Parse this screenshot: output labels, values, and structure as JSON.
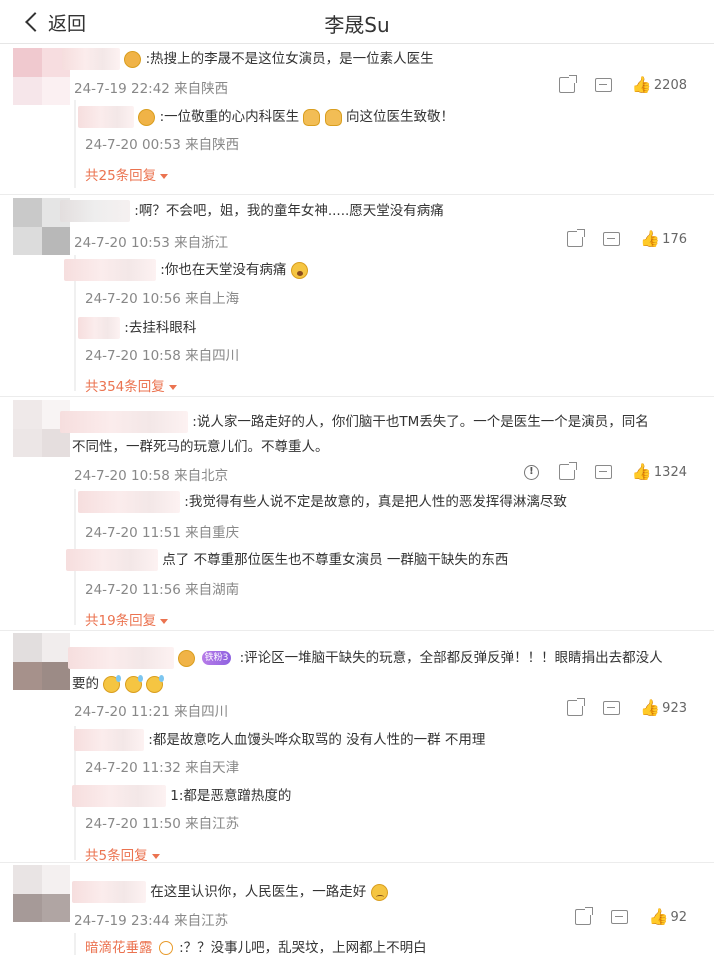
{
  "header": {
    "back_label": "返回",
    "title": "李晟Su"
  },
  "comments": [
    {
      "text": ":热搜上的李晟不是这位女演员，是一位素人医生",
      "meta": "24-7-19 22:42 来自陕西",
      "likes": "2208",
      "replies": [
        {
          "text": ":一位敬重的心内科医生",
          "text2": "向这位医生致敬！",
          "meta": "24-7-20 00:53 来自陕西"
        }
      ],
      "more": "共25条回复"
    },
    {
      "text": ":啊？不会吧，姐，我的童年女神.....愿天堂没有病痛",
      "meta": "24-7-20 10:53 来自浙江",
      "likes": "176",
      "replies": [
        {
          "text": ":你也在天堂没有病痛",
          "meta": "24-7-20 10:56 来自上海"
        },
        {
          "text": ":去挂科眼科",
          "meta": "24-7-20 10:58 来自四川"
        }
      ],
      "more": "共354条回复"
    },
    {
      "text": ":说人家一路走好的人，你们脑干也TM丢失了。一个是医生一个是演员，同名",
      "text_line2": "不同性，一群死马的玩意儿们。不尊重人。",
      "meta": "24-7-20 10:58 来自北京",
      "likes": "1324",
      "replies": [
        {
          "text": ":我觉得有些人说不定是故意的，真是把人性的恶发挥得淋漓尽致",
          "meta": "24-7-20 11:51 来自重庆"
        },
        {
          "text": "点了  不尊重那位医生也不尊重女演员 一群脑干缺失的东西",
          "meta": "24-7-20 11:56 来自湖南"
        }
      ],
      "more": "共19条回复"
    },
    {
      "badge": "铁粉3",
      "text": ":评论区一堆脑干缺失的玩意，全部都反弹反弹！！！眼睛捐出去都没人",
      "text_line2": "要的",
      "meta": "24-7-20 11:21 来自四川",
      "likes": "923",
      "replies": [
        {
          "text": ":都是故意吃人血馒头哗众取骂的 没有人性的一群 不用理",
          "meta": "24-7-20 11:32 来自天津"
        },
        {
          "text": "1:都是恶意蹭热度的",
          "meta": "24-7-20 11:50 来自江苏"
        }
      ],
      "more": "共5条回复"
    },
    {
      "text": "在这里认识你，人民医生，一路走好",
      "meta": "24-7-19 23:44 来自江苏",
      "likes": "92",
      "replies": [
        {
          "name": "暗滴花垂露",
          "text": ":？？没事儿吧，乱哭坟，上网都上不明白"
        }
      ]
    }
  ],
  "colors": {
    "accent": "#eb7350",
    "meta": "#888888",
    "divider": "#ececec"
  },
  "icons": [
    "back-chevron-icon",
    "share-icon",
    "comment-icon",
    "like-icon",
    "report-icon",
    "emoji-icon"
  ]
}
